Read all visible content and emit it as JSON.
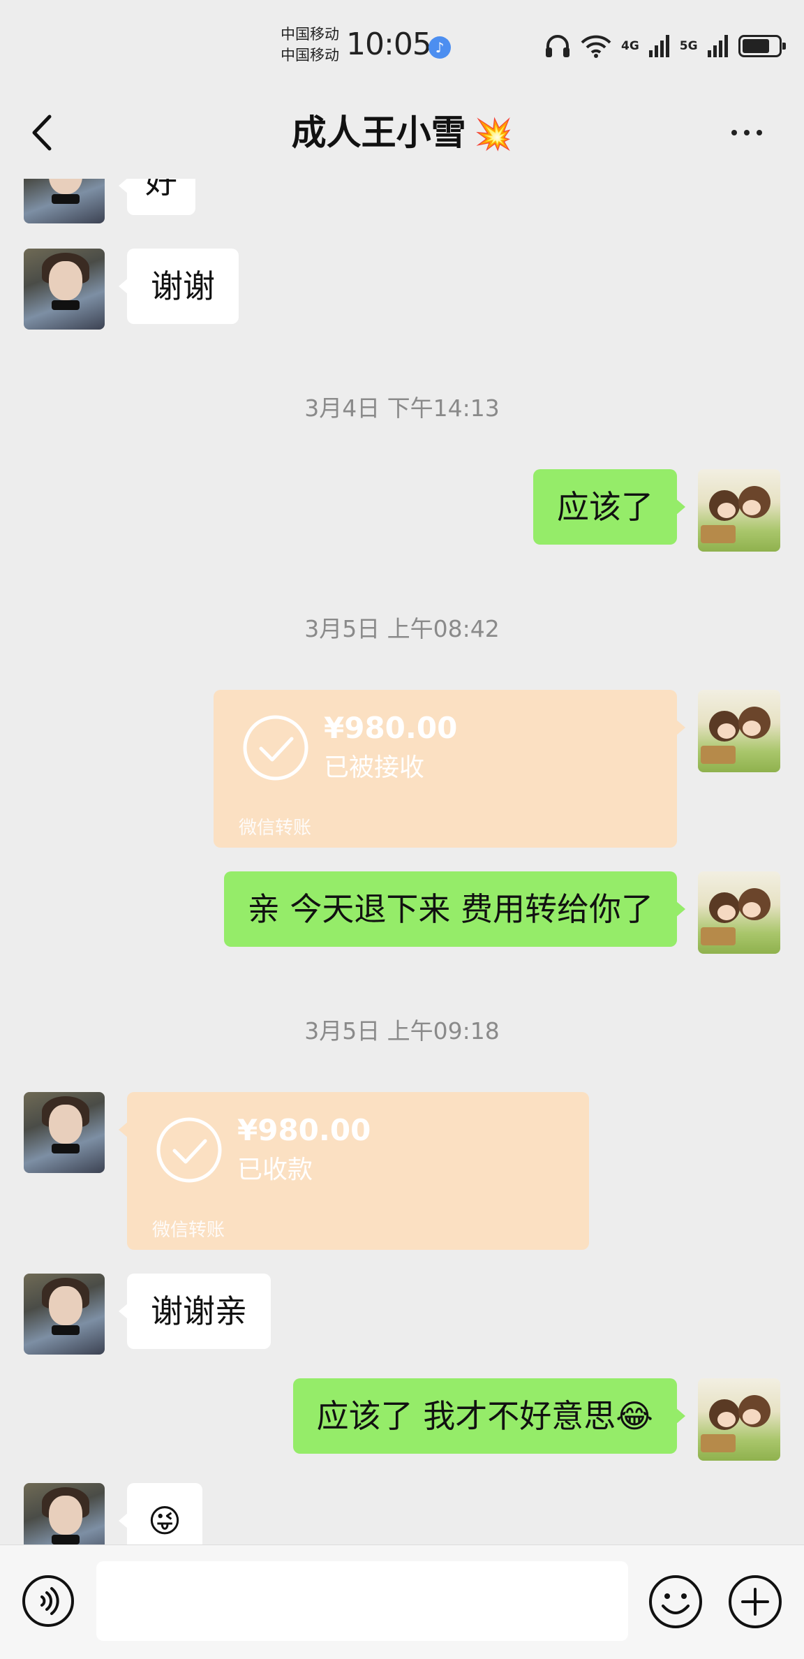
{
  "status_bar": {
    "carrier_1": "中国移动",
    "carrier_2": "中国移动",
    "time": "10:05",
    "net_1": "4G",
    "net_2": "5G"
  },
  "header": {
    "title": "成人王小雪",
    "title_emoji": "💥",
    "back_icon": "chevron-left-icon",
    "more_icon": "more-dots-icon"
  },
  "messages": [
    {
      "side": "left",
      "type": "text",
      "text": "好"
    },
    {
      "side": "left",
      "type": "text",
      "text": "谢谢"
    },
    {
      "type": "timestamp",
      "text": "3月4日 下午14:13"
    },
    {
      "side": "right",
      "type": "text",
      "text": "应该了"
    },
    {
      "type": "timestamp",
      "text": "3月5日 上午08:42"
    },
    {
      "side": "right",
      "type": "transfer",
      "amount": "¥980.00",
      "status": "已被接收",
      "label": "微信转账"
    },
    {
      "side": "right",
      "type": "text",
      "text": "亲 今天退下来 费用转给你了"
    },
    {
      "type": "timestamp",
      "text": "3月5日 上午09:18"
    },
    {
      "side": "left",
      "type": "transfer",
      "amount": "¥980.00",
      "status": "已收款",
      "label": "微信转账"
    },
    {
      "side": "left",
      "type": "text",
      "text": "谢谢亲"
    },
    {
      "side": "right",
      "type": "text",
      "text": "应该了   我才不好意思😂"
    },
    {
      "side": "left",
      "type": "text",
      "text": "😜"
    }
  ],
  "input_bar": {
    "voice_icon": "voice-icon",
    "text_value": "",
    "emoji_icon": "emoji-icon",
    "plus_icon": "plus-icon"
  },
  "colors": {
    "background": "#ededed",
    "bubble_self": "#95ec69",
    "bubble_other": "#ffffff",
    "transfer_card": "#fbe0c2",
    "timestamp": "#8a8a8a"
  }
}
